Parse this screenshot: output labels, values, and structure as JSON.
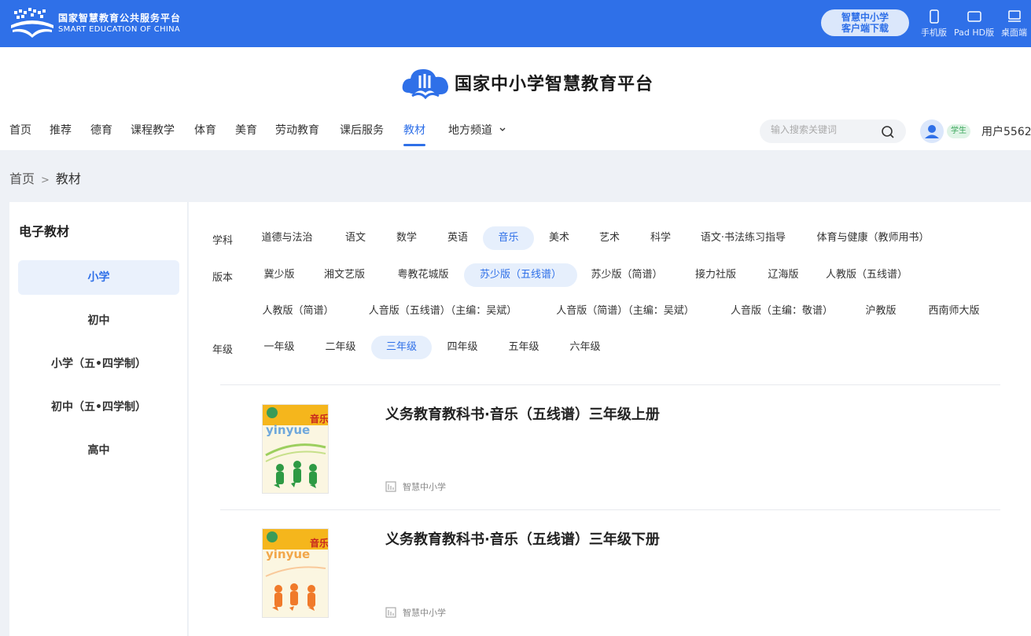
{
  "brand": {
    "name_cn": "国家智慧教育公共服务平台",
    "name_en": "SMART EDUCATION OF CHINA"
  },
  "app_download": {
    "line1": "智慧中小学",
    "line2": "客户端下载"
  },
  "devices": [
    {
      "label": "手机版",
      "icon": "phone-icon"
    },
    {
      "label": "Pad HD版",
      "icon": "tablet-icon"
    },
    {
      "label": "桌面端",
      "icon": "desktop-icon"
    }
  ],
  "site_title": "国家中小学智慧教育平台",
  "nav": [
    {
      "label": "首页"
    },
    {
      "label": "推荐"
    },
    {
      "label": "德育"
    },
    {
      "label": "课程教学"
    },
    {
      "label": "体育"
    },
    {
      "label": "美育"
    },
    {
      "label": "劳动教育"
    },
    {
      "label": "课后服务"
    },
    {
      "label": "教材",
      "active": true
    },
    {
      "label": "地方频道"
    }
  ],
  "search": {
    "placeholder": "输入搜索关键词"
  },
  "user": {
    "role": "学生",
    "name": "用户5562"
  },
  "breadcrumb": {
    "home": "首页",
    "sep": ">",
    "current": "教材"
  },
  "sidebar": {
    "title": "电子教材",
    "items": [
      {
        "label": "小学",
        "active": true
      },
      {
        "label": "初中"
      },
      {
        "label": "小学（五•四学制）"
      },
      {
        "label": "初中（五•四学制）"
      },
      {
        "label": "高中"
      }
    ]
  },
  "filters": {
    "subject": {
      "label": "学科",
      "options": [
        "道德与法治",
        "语文",
        "数学",
        "英语",
        "音乐",
        "美术",
        "艺术",
        "科学",
        "语文·书法练习指导",
        "体育与健康（教师用书）"
      ],
      "selected": "音乐"
    },
    "edition": {
      "label": "版本",
      "options": [
        "冀少版",
        "湘文艺版",
        "粤教花城版",
        "苏少版（五线谱）",
        "苏少版（简谱）",
        "接力社版",
        "辽海版",
        "人教版（五线谱）",
        "人教版（简谱）",
        "人音版（五线谱）（主编：吴斌）",
        "人音版（简谱）（主编：吴斌）",
        "人音版（主编：敬谱）",
        "沪教版",
        "西南师大版"
      ],
      "selected": "苏少版（五线谱）"
    },
    "grade": {
      "label": "年级",
      "options": [
        "一年级",
        "二年级",
        "三年级",
        "四年级",
        "五年级",
        "六年级"
      ],
      "selected": "三年级"
    }
  },
  "books": [
    {
      "title": "义务教育教科书·音乐（五线谱）三年级上册",
      "publisher": "智慧中小学",
      "cover_text": "音乐",
      "cover_word": "yinyue",
      "figure_color": "#2e9a44"
    },
    {
      "title": "义务教育教科书·音乐（五线谱）三年级下册",
      "publisher": "智慧中小学",
      "cover_text": "音乐",
      "cover_word": "yinyue",
      "figure_color": "#f07a2a"
    }
  ]
}
